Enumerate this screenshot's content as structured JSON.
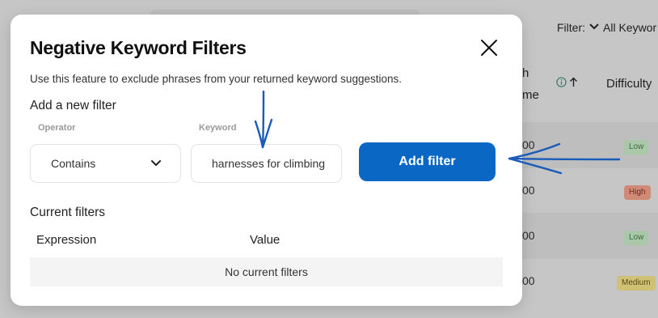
{
  "background": {
    "filter_label": "Filter:",
    "filter_value": "All Keywor",
    "col_volume_line1": "h",
    "col_volume_line2": "me",
    "col_difficulty": "Difficulty",
    "rows": [
      {
        "value": "00",
        "difficulty": "Low"
      },
      {
        "value": "00",
        "difficulty": "High"
      },
      {
        "value": "00",
        "difficulty": "Low"
      },
      {
        "value": "00",
        "difficulty": "Medium"
      }
    ]
  },
  "modal": {
    "title": "Negative Keyword Filters",
    "description": "Use this feature to exclude phrases from your returned keyword suggestions.",
    "add_heading": "Add a new filter",
    "operator_label": "Operator",
    "operator_value": "Contains",
    "keyword_label": "Keyword",
    "keyword_value": "harnesses for climbing",
    "add_button": "Add filter",
    "current_heading": "Current filters",
    "table_headers": [
      "Expression",
      "Value"
    ],
    "empty_text": "No current filters"
  },
  "colors": {
    "accent": "#0a68c4",
    "annotation": "#1a5bb8"
  },
  "icons": [
    "close-icon",
    "chevron-down-icon",
    "info-icon",
    "sort-up-icon"
  ]
}
